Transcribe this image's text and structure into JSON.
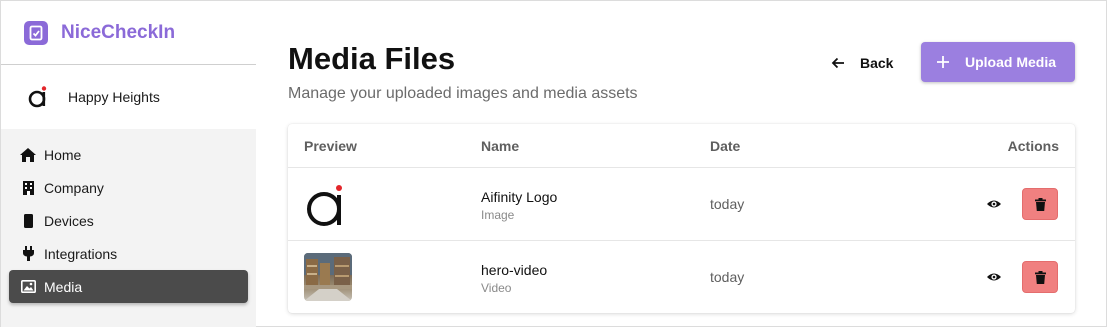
{
  "brand": {
    "name": "NiceCheckIn",
    "color": "#8b6ad8"
  },
  "org": {
    "name": "Happy Heights"
  },
  "sidebar": {
    "items": [
      {
        "label": "Home",
        "icon": "home-icon",
        "active": false
      },
      {
        "label": "Company",
        "icon": "building-icon",
        "active": false
      },
      {
        "label": "Devices",
        "icon": "device-icon",
        "active": false
      },
      {
        "label": "Integrations",
        "icon": "plug-icon",
        "active": false
      },
      {
        "label": "Media",
        "icon": "image-icon",
        "active": true
      }
    ]
  },
  "header": {
    "title": "Media Files",
    "subtitle": "Manage your uploaded images and media assets",
    "back_label": "Back",
    "upload_label": "Upload Media",
    "upload_color": "#9b7fe0"
  },
  "table": {
    "columns": {
      "preview": "Preview",
      "name": "Name",
      "date": "Date",
      "actions": "Actions"
    },
    "rows": [
      {
        "name": "Aifinity Logo",
        "type": "Image",
        "date": "today",
        "preview": "aifinity-logo"
      },
      {
        "name": "hero-video",
        "type": "Video",
        "date": "today",
        "preview": "warehouse-thumbnail"
      }
    ]
  },
  "colors": {
    "delete": "#f08080",
    "active_nav": "#4b4b4b"
  }
}
